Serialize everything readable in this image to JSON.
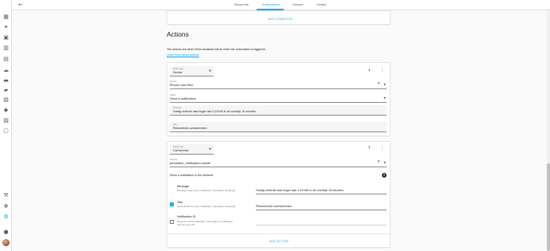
{
  "sidebar": {
    "icons": [
      "dashboard-icon",
      "map-icon",
      "logbook-icon",
      "history-icon",
      "energy-icon",
      "media-icon",
      "calendar-icon",
      "todo-icon",
      "hacs-icon",
      "vscode-icon",
      "nodered-icon",
      "terminal-icon",
      "esphome-icon",
      "database-icon",
      "hammer-icon",
      "settings-icon",
      "bell-icon"
    ]
  },
  "header": {
    "tabs": [
      "Blueprints",
      "Automations",
      "Scenes",
      "Scripts"
    ],
    "active_tab": "Automations"
  },
  "top": {
    "add_condition": "ADD CONDITION"
  },
  "actions": {
    "heading": "Actions",
    "description": "The actions are what Home Assistant will do when the automation is triggered.",
    "learn_more": "Learn more about actions"
  },
  "action1": {
    "type_label": "Action type",
    "type_value": "Device",
    "device_label": "Device",
    "device_value": "iPhone van Rien",
    "action_label": "Action",
    "action_value": "Send a notification",
    "message_label": "Message",
    "message_value": "Huidig verbruik was hoger dan 3,15 kW in de voorbije 15 minuten.",
    "title_label": "Title",
    "title_value": "Piekverbruik overschreden"
  },
  "action2": {
    "type_label": "Action type",
    "type_value": "Call service",
    "service_label": "Service",
    "service_value": "persistent_notification.create",
    "service_description": "Show a notification in the frontend.",
    "message_title": "Message",
    "message_sub": "Message body of the notification. [Templates accepted]",
    "message_value": "Huidig verbruik was hoger dan 3,15 kW in de voorbije 15 minuten.",
    "title_title": "Title",
    "title_sub": "Optional title for your notification. [Templates accepted]",
    "title_value": "Piekverbruik overschreden",
    "nid_title": "Notification ID",
    "nid_sub_1": "Target ID of the notification, will replace a notification",
    "nid_sub_2": "with the same ID.",
    "add_action": "ADD ACTION"
  },
  "colors": {
    "accent": "#03a9f4",
    "background": "#fafafa",
    "card": "#ffffff",
    "field": "#f5f5f5"
  }
}
